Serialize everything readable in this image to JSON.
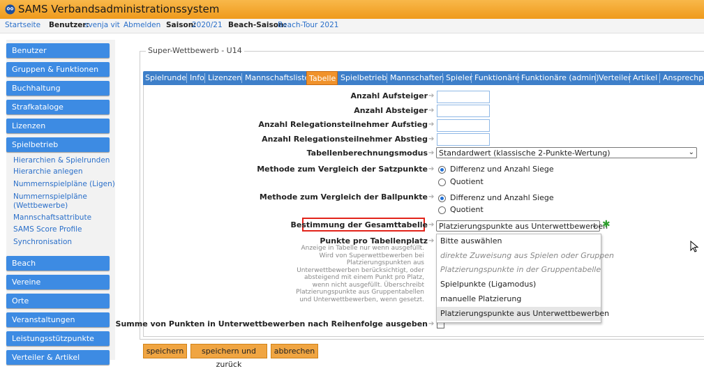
{
  "app": {
    "title": "SAMS Verbandsadministrationssystem",
    "logo_icon": "owl-icon"
  },
  "topbar": {
    "startseite": "Startseite",
    "benutzer_label": "Benutzer:",
    "benutzer_value": "svenja vit",
    "abmelden": "Abmelden",
    "saison_label": "Saison:",
    "saison_value": "2020/21",
    "beach_label": "Beach-Saison:",
    "beach_value": "Beach-Tour 2021"
  },
  "sidebar": {
    "benutzer": "Benutzer",
    "gruppen": "Gruppen & Funktionen",
    "buchhaltung": "Buchhaltung",
    "strafkataloge": "Strafkataloge",
    "lizenzen": "Lizenzen",
    "spielbetrieb": "Spielbetrieb",
    "sub": {
      "hierarchien": "Hierarchien & Spielrunden",
      "hierarchie_anlegen": "Hierarchie anlegen",
      "nummern_ligen": "Nummernspielpläne (Ligen)",
      "nummern_wett": "Nummernspielpläne (Wettbewerbe)",
      "mannschaftsattribute": "Mannschaftsattribute",
      "score_profile": "SAMS Score Profile",
      "synchronisation": "Synchronisation"
    },
    "beach": "Beach",
    "vereine": "Vereine",
    "orte": "Orte",
    "veranstaltungen": "Veranstaltungen",
    "leistungsstuetzpunkte": "Leistungsstützpunkte",
    "verteiler": "Verteiler & Artikel"
  },
  "main": {
    "legend": "Super-Wettbewerb - U14",
    "tabs": {
      "spielrunde": "Spielrunde",
      "info": "Info",
      "lizenzen": "Lizenzen",
      "mannschaftsliste": "Mannschaftsliste",
      "tabelle": "Tabelle",
      "spielbetrieb": "Spielbetrieb",
      "mannschaften": "Mannschaften",
      "spieler": "Spieler",
      "funktionaere": "Funktionäre",
      "funktionaere_admin": "Funktionäre (admin)",
      "verteiler": "Verteiler",
      "artikel": "Artikel",
      "ansprechpartner": "Ansprechpa"
    },
    "form": {
      "aufsteiger_label": "Anzahl Aufsteiger",
      "aufsteiger_value": "",
      "absteiger_label": "Anzahl Absteiger",
      "absteiger_value": "",
      "rel_auf_label": "Anzahl Relegationsteilnehmer Aufstieg",
      "rel_auf_value": "",
      "rel_ab_label": "Anzahl Relegationsteilnehmer Abstieg",
      "rel_ab_value": "",
      "modus_label": "Tabellenberechnungsmodus",
      "modus_value": "Standardwert (klassische 2-Punkte-Wertung)",
      "satz_label": "Methode zum Vergleich der Satzpunkte",
      "satz_opt1": "Differenz und Anzahl Siege",
      "satz_opt2": "Quotient",
      "ball_label": "Methode zum Vergleich der Ballpunkte",
      "ball_opt1": "Differenz und Anzahl Siege",
      "ball_opt2": "Quotient",
      "gesamt_label": "Bestimmung der Gesamttabelle",
      "gesamt_value": "Platzierungspunkte aus Unterwettbewerben",
      "punkte_label": "Punkte pro Tabellenplatz",
      "punkte_help": "Anzeige in Tabelle nur wenn ausgefüllt. Wird von Superwettbewerben bei Platzierungspunkten aus Unterwettbewerben berücksichtigt, oder absteigend mit einem Punkt pro Platz, wenn nicht ausgefüllt. Überschreibt Platzierungspunkte aus Gruppentabellen und Unterwettbewerben, wenn gesetzt.",
      "summe_label": "Summe von Punkten in Unterwettbewerben nach Reihenfolge ausgeben"
    },
    "dropdown": {
      "opt1": "Bitte auswählen",
      "opt2": "direkte Zuweisung aus Spielen oder Gruppen",
      "opt3": "Platzierungspunkte in der Gruppentabelle",
      "opt4": "Spielpunkte (Ligamodus)",
      "opt5": "manuelle Platzierung",
      "opt6": "Platzierungspunkte aus Unterwettbewerben"
    },
    "buttons": {
      "save": "speichern",
      "save_back": "speichern und zurück",
      "cancel": "abbrechen"
    }
  },
  "colors": {
    "orange": "#f0922b",
    "blue": "#3d8be3",
    "red_highlight": "#e2231a"
  }
}
